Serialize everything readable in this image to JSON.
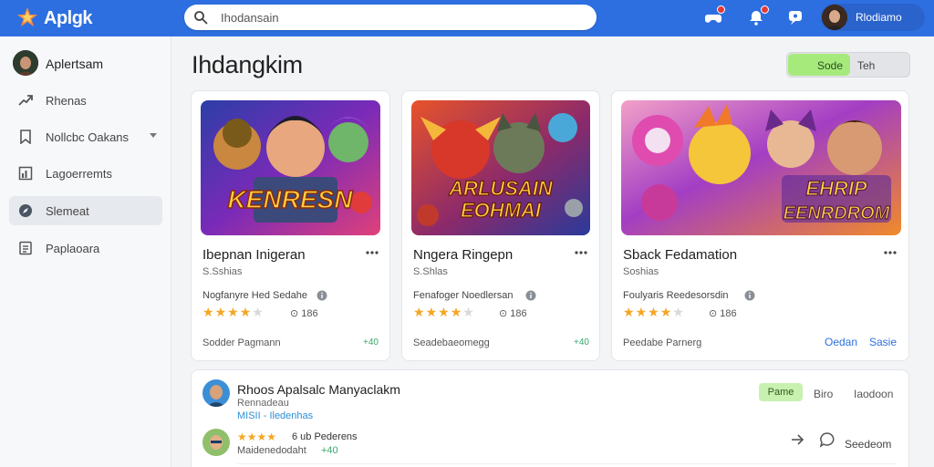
{
  "app": {
    "name": "Aplgk"
  },
  "search": {
    "value": "Ihodansain"
  },
  "header": {
    "user_name": "Rlodiamo"
  },
  "sidebar": {
    "profile_name": "Aplertsam",
    "items": [
      {
        "label": "Rhenas",
        "icon": "trending-icon"
      },
      {
        "label": "Nollcbc Oakans",
        "icon": "bookmark-icon"
      },
      {
        "label": "Lagoerremts",
        "icon": "chart-icon"
      },
      {
        "label": "Slemeat",
        "icon": "explore-icon"
      },
      {
        "label": "Paplaoara",
        "icon": "document-icon"
      }
    ],
    "active_index": 3
  },
  "main": {
    "title": "Ihdangkim",
    "toggle_on": "Sode",
    "toggle_off": "Teh"
  },
  "cards": [
    {
      "banner": "KENRESN",
      "title": "Ibepnan Inigeran",
      "subtitle": "S.Sshias",
      "developer": "Nogfanyre Hed Sedahe",
      "rating": 4,
      "rating_count": "186",
      "footer_left": "Sodder Pagmann",
      "footer_right": "+40"
    },
    {
      "banner_line1": "ARLUSAIN",
      "banner_line2": "EOHMAI",
      "title": "Nngera Ringepn",
      "subtitle": "S.Shlas",
      "developer": "Fenafoger Noedlersan",
      "rating": 4,
      "rating_count": "186",
      "footer_left": "Seadebaeomegg",
      "footer_right": "+40"
    },
    {
      "banner_line1": "EHRIP",
      "banner_line2": "EENRDROM",
      "title": "Sback Fedamation",
      "subtitle": "Soshias",
      "developer": "Foulyaris Reedesorsdin",
      "rating": 4,
      "rating_count": "186",
      "footer_left": "Peedabe Parnerg",
      "link1": "Oedan",
      "link2": "Sasie"
    }
  ],
  "panel": {
    "title": "Rhoos Apalsalc Manyaclakm",
    "subtitle": "Rennadeau",
    "link": "MISII - Iledenhas",
    "badge": "Pame",
    "btn1": "Biro",
    "btn2": "Iaodoon",
    "reviewer": "6 ub Pederens",
    "meta": "Maidenedodaht",
    "meta2": "+40",
    "action": "Seedeom"
  },
  "colors": {
    "topbar": "#2d6fe0",
    "accent_green": "#a6ea7c",
    "star": "#f5a623"
  }
}
